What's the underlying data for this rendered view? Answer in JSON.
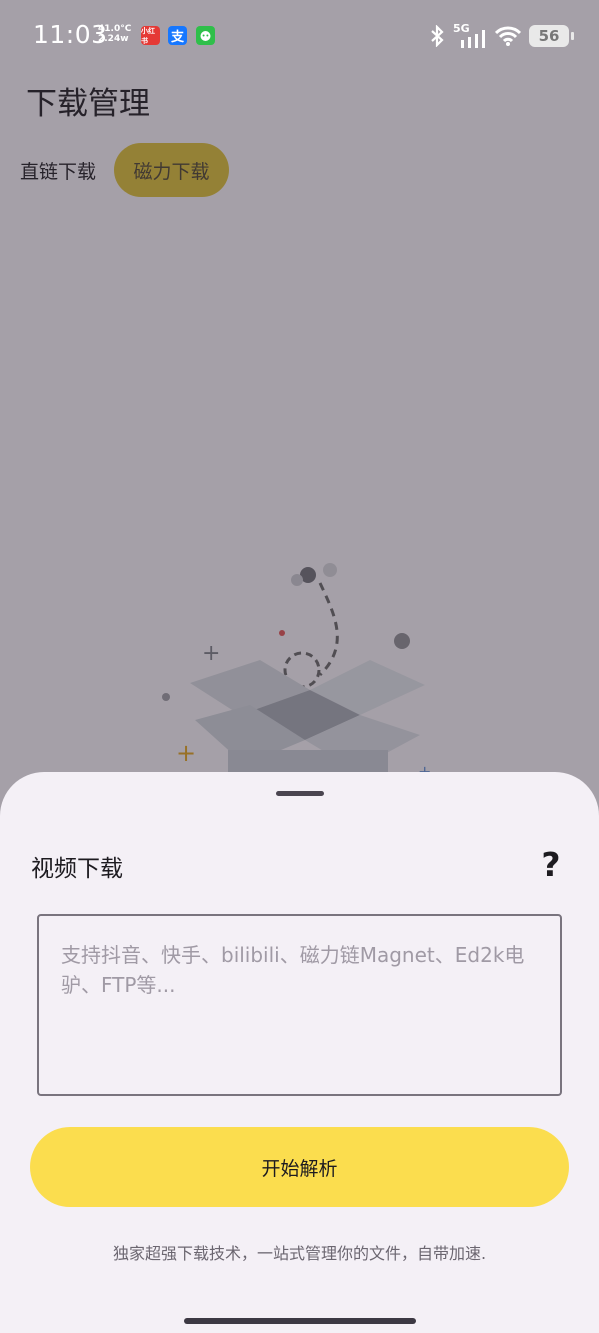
{
  "status_bar": {
    "time": "11:03",
    "temperature": "41.0°C",
    "power": "2.24w",
    "app_badges": [
      {
        "name": "xiaohongshu",
        "label": "小红书",
        "color": "#e53935"
      },
      {
        "name": "alipay",
        "label": "支",
        "color": "#1677ff"
      },
      {
        "name": "wechat-mini",
        "label": "",
        "color": "#2fbf4a"
      }
    ],
    "network": "5G",
    "battery": "56"
  },
  "header": {
    "title": "下载管理"
  },
  "tabs": [
    {
      "label": "直链下载",
      "selected": false
    },
    {
      "label": "磁力下载",
      "selected": true
    }
  ],
  "sheet": {
    "title": "视频下载",
    "help_symbol": "?",
    "input": {
      "value": "",
      "placeholder": "支持抖音、快手、bilibili、磁力链Magnet、Ed2k电驴、FTP等..."
    },
    "start_button": "开始解析",
    "tagline": "独家超强下载技术，一站式管理你的文件，自带加速."
  },
  "colors": {
    "accent": "#fbdd4e",
    "selected_tab": "#d9be34",
    "sheet_background": "#f4f0f6"
  }
}
